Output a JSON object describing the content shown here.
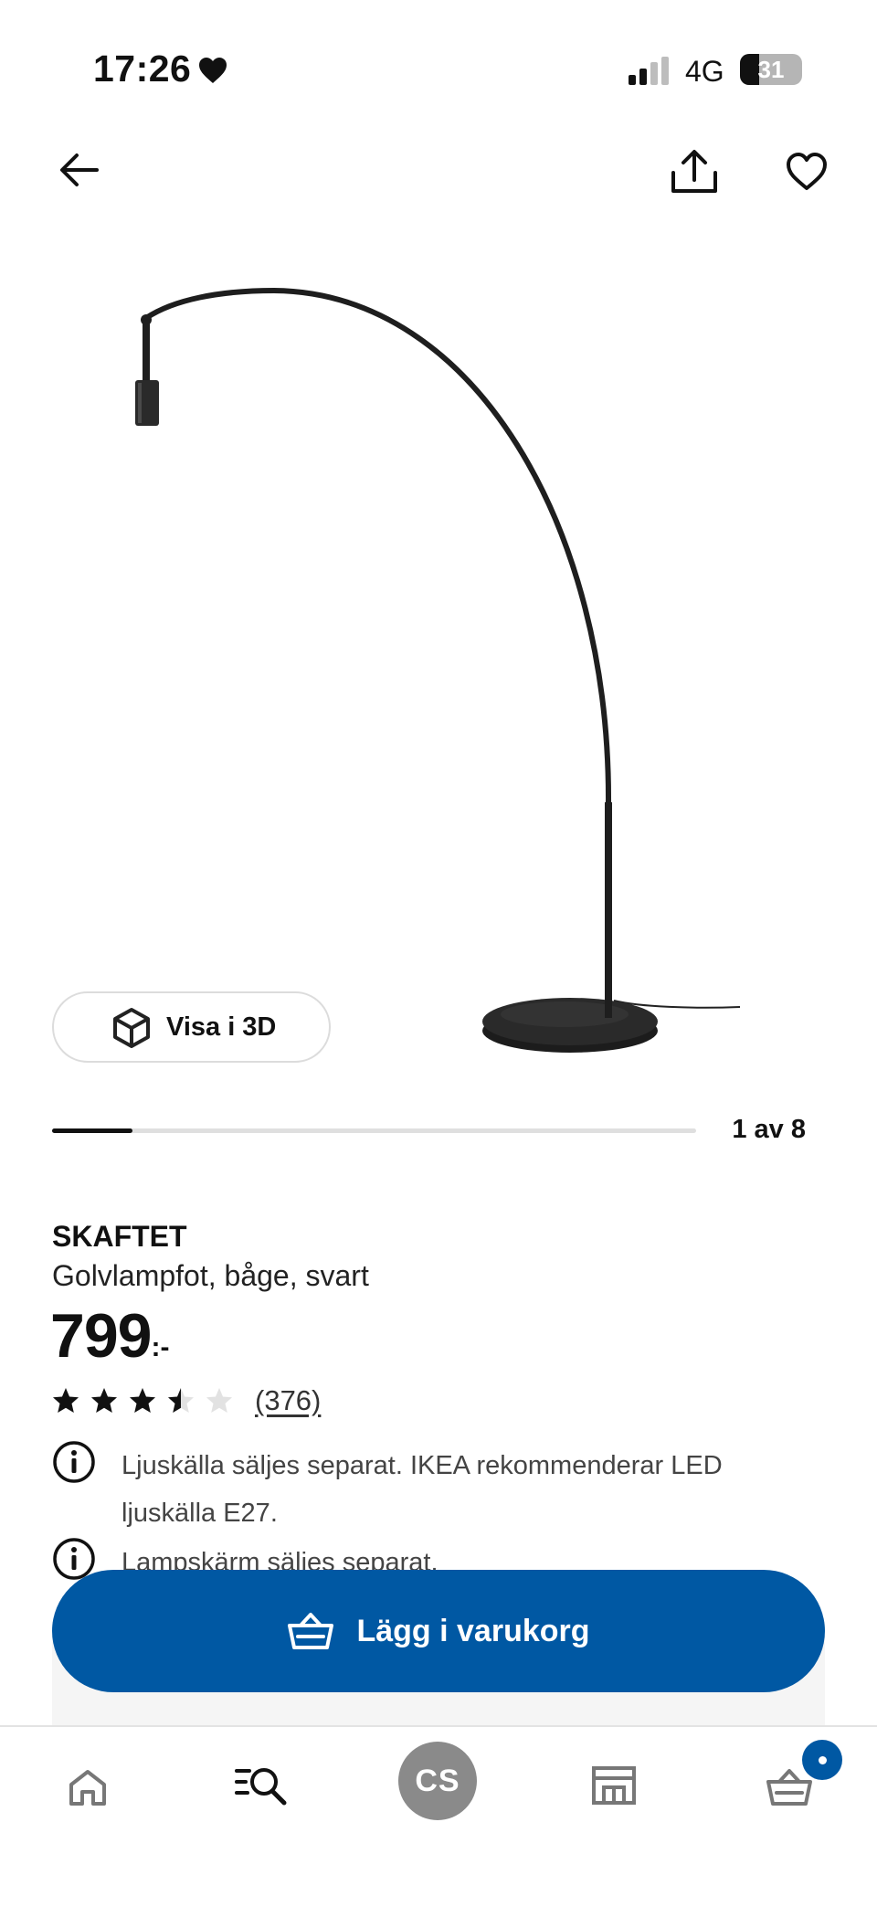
{
  "status_bar": {
    "time": "17:26",
    "network": "4G",
    "battery": "31",
    "battery_level": 0.31
  },
  "product": {
    "name": "SKAFTET",
    "description": "Golvlampfot, båge, svart",
    "price": "799",
    "price_suffix": ":-",
    "rating": 3.5,
    "rating_max": 5,
    "review_count": "(376)"
  },
  "gallery": {
    "view_3d_label": "Visa i 3D",
    "position_text": "1 av 8",
    "progress": 0.125
  },
  "notices": [
    {
      "text": "Ljuskälla säljes separat. IKEA rekommenderar LED ljuskälla E27."
    },
    {
      "text": "Lampskärm säljes separat."
    }
  ],
  "actions": {
    "add_to_cart_label": "Lägg i varukorg"
  },
  "bottom_nav": {
    "profile_initials": "CS",
    "items": [
      "home-icon",
      "search-icon",
      "profile-avatar",
      "store-icon",
      "cart-icon"
    ]
  },
  "colors": {
    "accent": "#0058a3",
    "text": "#111111"
  }
}
